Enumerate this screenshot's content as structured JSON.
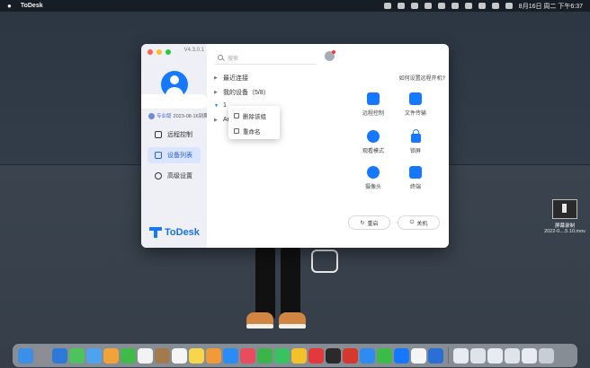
{
  "menubar": {
    "app_name": "ToDesk",
    "datetime": "8月16日 周二 下午6:37"
  },
  "window": {
    "version": "V4.3.0.1",
    "sidebar": {
      "member_tag": "专业版",
      "member_expiry": "2023-08-16到期",
      "nav": [
        {
          "label": "远程控制",
          "icon": "monitor-icon"
        },
        {
          "label": "设备列表",
          "icon": "device-list-icon"
        },
        {
          "label": "高级设置",
          "icon": "settings-icon"
        }
      ],
      "logo_text": "ToDesk"
    },
    "main": {
      "search_placeholder": "搜索",
      "help_link": "如何设置远程开机?",
      "tree": [
        {
          "label": "最近连接",
          "expanded": false
        },
        {
          "label": "我的设备（5/8）",
          "expanded": false
        },
        {
          "label": "1",
          "expanded": true
        },
        {
          "label": "An",
          "expanded": false
        }
      ],
      "tools": [
        {
          "label": "远程控制",
          "icon": "remote-control-icon"
        },
        {
          "label": "文件传输",
          "icon": "file-transfer-icon"
        },
        {
          "label": "观看模式",
          "icon": "eye-icon"
        },
        {
          "label": "锁屏",
          "icon": "lock-icon"
        },
        {
          "label": "摄像头",
          "icon": "camera-icon"
        },
        {
          "label": "终端",
          "icon": "terminal-icon"
        }
      ],
      "buttons": {
        "restart": "重启",
        "shutdown": "关机"
      }
    },
    "context_menu": {
      "delete_group": "删除该组",
      "rename": "重命名"
    }
  },
  "desktop_file": {
    "name": "屏幕录制",
    "date": "2022-0....5.10.mov"
  },
  "colors": {
    "accent": "#1677ff",
    "active_nav_bg": "#d9e4ff"
  }
}
